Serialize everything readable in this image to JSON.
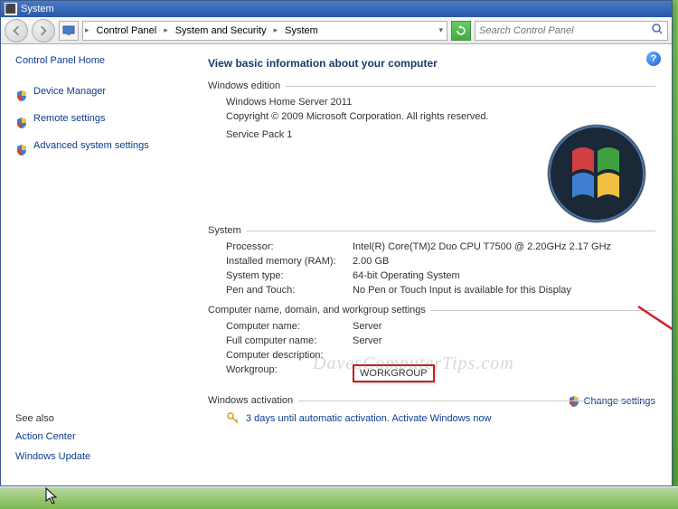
{
  "window": {
    "title": "System"
  },
  "breadcrumb": {
    "seg1": "Control Panel",
    "seg2": "System and Security",
    "seg3": "System"
  },
  "search": {
    "placeholder": "Search Control Panel"
  },
  "sidebar": {
    "home": "Control Panel Home",
    "links": [
      "Device Manager",
      "Remote settings",
      "Advanced system settings"
    ],
    "see_also_hdr": "See also",
    "see_also": [
      "Action Center",
      "Windows Update"
    ]
  },
  "main": {
    "title": "View basic information about your computer",
    "windows_edition_hdr": "Windows edition",
    "edition": "Windows Home Server 2011",
    "copyright": "Copyright © 2009 Microsoft Corporation.  All rights reserved.",
    "sp": "Service Pack 1",
    "system_hdr": "System",
    "processor_lbl": "Processor:",
    "processor_val": "Intel(R) Core(TM)2 Duo CPU    T7500  @ 2.20GHz   2.17 GHz",
    "ram_lbl": "Installed memory (RAM):",
    "ram_val": "2.00 GB",
    "systype_lbl": "System type:",
    "systype_val": "64-bit Operating System",
    "pen_lbl": "Pen and Touch:",
    "pen_val": "No Pen or Touch Input is available for this Display",
    "compname_hdr": "Computer name, domain, and workgroup settings",
    "compname_lbl": "Computer name:",
    "compname_val": "Server",
    "fullname_lbl": "Full computer name:",
    "fullname_val": "Server",
    "compdesc_lbl": "Computer description:",
    "compdesc_val": "",
    "workgroup_lbl": "Workgroup:",
    "workgroup_val": "WORKGROUP",
    "change_settings": "Change settings",
    "activation_hdr": "Windows activation",
    "activation_text": "3 days until automatic activation. Activate Windows now"
  },
  "watermark": "DavesComputerTips.com"
}
